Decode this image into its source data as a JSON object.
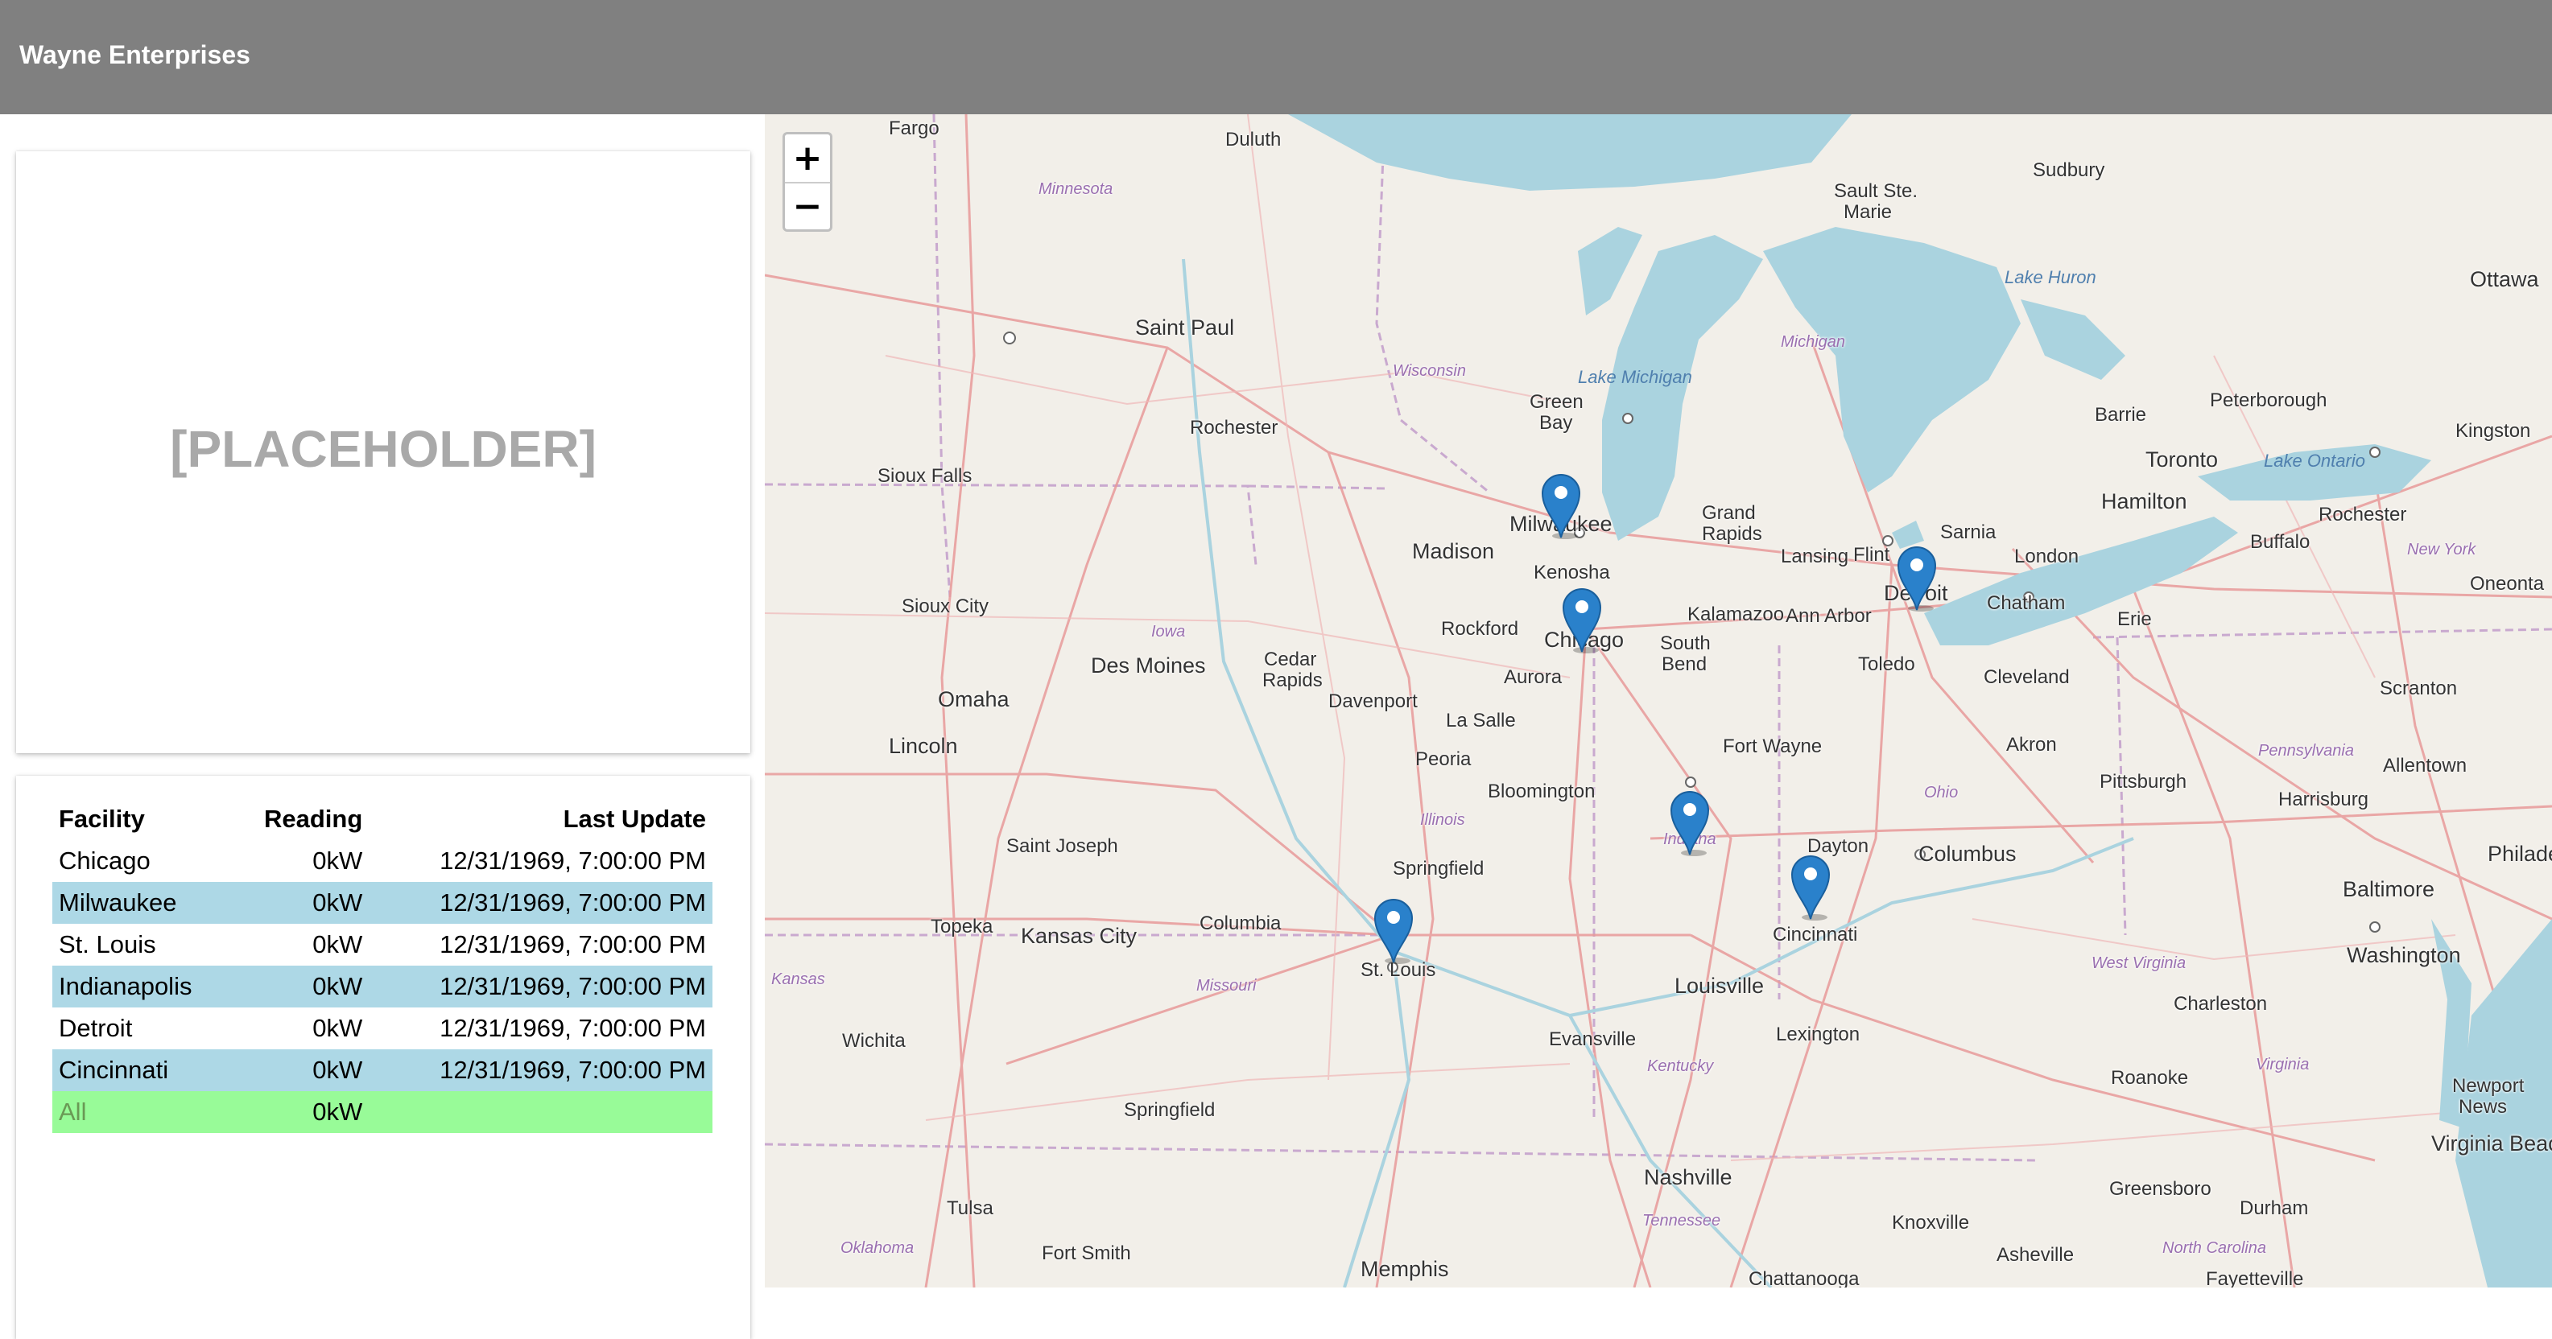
{
  "header": {
    "title": "Wayne Enterprises"
  },
  "placeholder": {
    "text": "[PLACEHOLDER]"
  },
  "table": {
    "headers": {
      "facility": "Facility",
      "reading": "Reading",
      "last_update": "Last Update"
    },
    "rows": [
      {
        "facility": "Chicago",
        "reading": "0kW",
        "last_update": "12/31/1969, 7:00:00 PM"
      },
      {
        "facility": "Milwaukee",
        "reading": "0kW",
        "last_update": "12/31/1969, 7:00:00 PM"
      },
      {
        "facility": "St. Louis",
        "reading": "0kW",
        "last_update": "12/31/1969, 7:00:00 PM"
      },
      {
        "facility": "Indianapolis",
        "reading": "0kW",
        "last_update": "12/31/1969, 7:00:00 PM"
      },
      {
        "facility": "Detroit",
        "reading": "0kW",
        "last_update": "12/31/1969, 7:00:00 PM"
      },
      {
        "facility": "Cincinnati",
        "reading": "0kW",
        "last_update": "12/31/1969, 7:00:00 PM"
      }
    ],
    "total": {
      "facility": "All",
      "reading": "0kW",
      "last_update": ""
    }
  },
  "map": {
    "zoom_in": "+",
    "zoom_out": "−",
    "labels": {
      "fargo": "Fargo",
      "duluth": "Duluth",
      "minnesota": "Minnesota",
      "sault_ste_marie_1": "Sault Ste.",
      "sault_ste_marie_2": "Marie",
      "sudbury": "Sudbury",
      "lake_huron": "Lake Huron",
      "ottawa": "Ottawa",
      "saint_paul": "Saint Paul",
      "wisconsin": "Wisconsin",
      "michigan": "Michigan",
      "lake_michigan": "Lake Michigan",
      "green_bay_1": "Green",
      "green_bay_2": "Bay",
      "rochester_mn": "Rochester",
      "peterborough": "Peterborough",
      "barrie": "Barrie",
      "kingston": "Kingston",
      "toronto": "Toronto",
      "lake_ontario": "Lake Ontario",
      "sioux_falls": "Sioux Falls",
      "milwaukee": "Milwaukee",
      "madison": "Madison",
      "grand_rapids_1": "Grand",
      "grand_rapids_2": "Rapids",
      "hamilton": "Hamilton",
      "rochester_ny": "Rochester",
      "sarnia": "Sarnia",
      "lansing": "Lansing",
      "flint": "Flint",
      "london": "London",
      "buffalo": "Buffalo",
      "new_york": "New York",
      "kenosha": "Kenosha",
      "sioux_city": "Sioux City",
      "oneonta": "Oneonta",
      "detroit": "Detroit",
      "rockford": "Rockford",
      "chicago": "Chicago",
      "kalamazoo": "Kalamazoo",
      "ann_arbor": "Ann Arbor",
      "chatham": "Chatham",
      "erie": "Erie",
      "iowa": "Iowa",
      "des_moines": "Des Moines",
      "cedar_rapids_1": "Cedar",
      "cedar_rapids_2": "Rapids",
      "aurora": "Aurora",
      "south_bend_1": "South",
      "south_bend_2": "Bend",
      "toledo": "Toledo",
      "cleveland": "Cleveland",
      "omaha": "Omaha",
      "davenport": "Davenport",
      "la_salle": "La Salle",
      "scranton": "Scranton",
      "lincoln": "Lincoln",
      "fort_wayne": "Fort Wayne",
      "akron": "Akron",
      "pennsylvania": "Pennsylvania",
      "peoria": "Peoria",
      "allentown": "Allentown",
      "ohio": "Ohio",
      "pittsburgh": "Pittsburgh",
      "bloomington": "Bloomington",
      "harrisburg": "Harrisburg",
      "illinois": "Illinois",
      "saint_joseph": "Saint Joseph",
      "dayton": "Dayton",
      "indiana": "Indiana",
      "columbus_oh": "Columbus",
      "philadelphia": "Philadelphia",
      "springfield_il": "Springfield",
      "baltimore": "Baltimore",
      "topeka": "Topeka",
      "kansas_city": "Kansas City",
      "columbia": "Columbia",
      "cincinnati": "Cincinnati",
      "washington": "Washington",
      "st_louis": "St. Louis",
      "missouri": "Missouri",
      "louisville": "Louisville",
      "kansas": "Kansas",
      "west_virginia": "West Virginia",
      "charleston": "Charleston",
      "wichita": "Wichita",
      "evansville": "Evansville",
      "lexington": "Lexington",
      "kentucky": "Kentucky",
      "virginia": "Virginia",
      "roanoke": "Roanoke",
      "newport_news_1": "Newport",
      "newport_news_2": "News",
      "springfield_mo": "Springfield",
      "virginia_beach": "Virginia Beach",
      "nashville": "Nashville",
      "tulsa": "Tulsa",
      "greensboro": "Greensboro",
      "durham": "Durham",
      "tennessee": "Tennessee",
      "knoxville": "Knoxville",
      "oklahoma": "Oklahoma",
      "fort_smith": "Fort Smith",
      "asheville": "Asheville",
      "north_carolina": "North Carolina",
      "memphis": "Memphis",
      "chattanooga": "Chattanooga",
      "fayetteville": "Fayetteville"
    }
  },
  "colors": {
    "header_bg": "#808080",
    "row_alt": "#add8e6",
    "row_total": "#98fb98",
    "water": "#aad3df",
    "land": "#f2efe9",
    "marker": "#2a81cb"
  }
}
